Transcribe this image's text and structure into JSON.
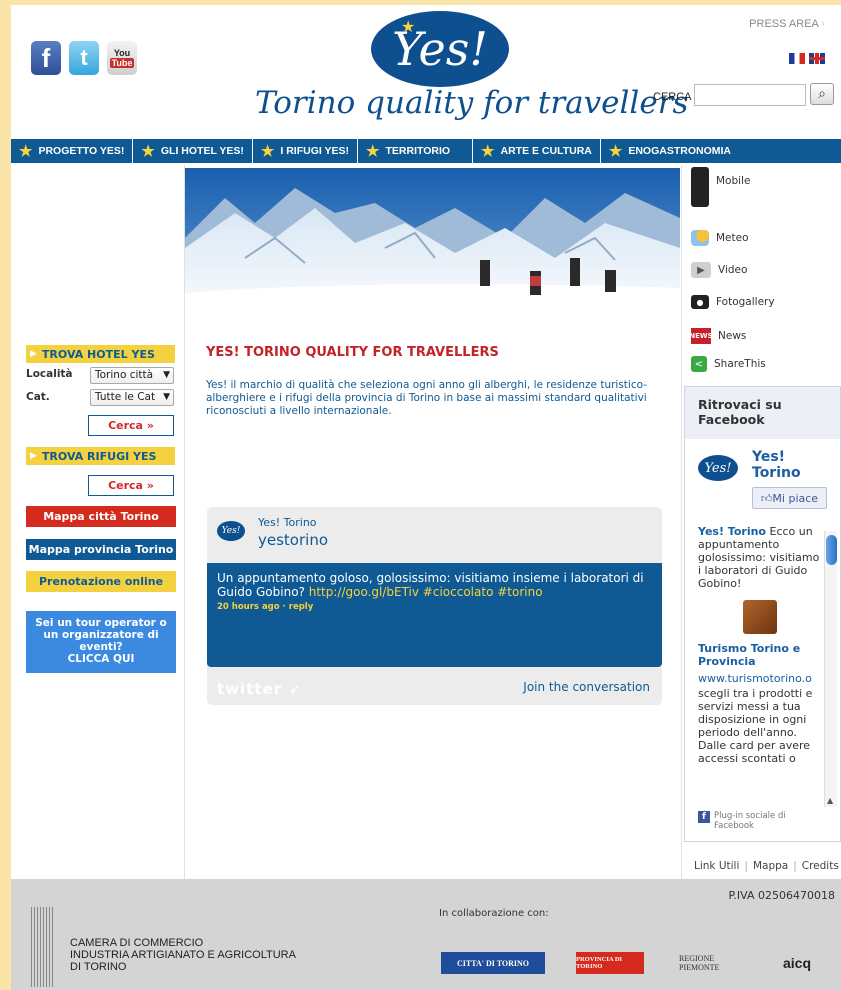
{
  "header": {
    "press_area": "PRESS AREA",
    "logo_text": "Yes!",
    "tagline": "Torino quality for travellers",
    "search_label": "CERCA",
    "search_placeholder": ""
  },
  "social": [
    {
      "name": "facebook",
      "glyph": "f"
    },
    {
      "name": "twitter",
      "glyph": "t"
    },
    {
      "name": "youtube",
      "glyph_top": "You",
      "glyph_bottom": "Tube"
    }
  ],
  "nav": [
    "PROGETTO YES!",
    "GLI HOTEL YES!",
    "I RIFUGI YES!",
    "TERRITORIO",
    "ARTE E CULTURA",
    "ENOGASTRONOMIA"
  ],
  "left": {
    "hotel_title": "TROVA HOTEL YES",
    "localita_label": "Località",
    "localita_value": "Torino città",
    "cat_label": "Cat.",
    "cat_value": "Tutte le Cat",
    "cerca_1": "Cerca »",
    "rifugi_title": "TROVA RIFUGI YES",
    "cerca_2": "Cerca »",
    "mappa_citta": "Mappa città Torino",
    "mappa_provincia": "Mappa provincia Torino",
    "prenotazione": "Prenotazione online",
    "tour_line1": "Sei un tour operator o",
    "tour_line2": "un organizzatore di",
    "tour_line3": "eventi?",
    "tour_line4": "CLICCA QUI"
  },
  "main": {
    "title": "YES! TORINO QUALITY FOR TRAVELLERS",
    "text": "Yes! il marchio di qualità che seleziona ogni anno gli alberghi, le residenze turistico-alberghiere e i rifugi della provincia di Torino in base ai massimi standard qualitativi riconosciuti a livello internazionale."
  },
  "twitter": {
    "name": "Yes! Torino",
    "handle": "yestorino",
    "avatar": "Yes!",
    "tweet_text": "Un appuntamento goloso, golosissimo: visitiamo insieme i laboratori di Guido Gobino? ",
    "tweet_link": "http://goo.gl/bETiv #cioccolato #torino",
    "meta": "20 hours ago · reply",
    "logo": "twitter",
    "join": "Join the conversation"
  },
  "right_links": [
    "Mobile",
    "Meteo",
    "Video",
    "Fotogallery",
    "News",
    "ShareThis"
  ],
  "facebook": {
    "title": "Ritrovaci su Facebook",
    "page_name": "Yes! Torino",
    "avatar": "Yes!",
    "like": "Mi piace",
    "post1_author": "Yes! Torino",
    "post1_text": " Ecco un appuntamento golosissimo: visitiamo i laboratori di Guido Gobino!",
    "post2_title": "Turismo Torino e Provincia",
    "post2_url": "www.turismotorino.o",
    "post2_text": "scegli tra i prodotti e servizi messi a tua disposizione in ogni periodo dell'anno. Dalle card per avere accessi scontati o",
    "plugin_text": "Plug-in sociale di Facebook"
  },
  "footer_links": [
    "Link Utili",
    "Mappa",
    "Credits"
  ],
  "footer": {
    "piva": "P.IVA 02506470018",
    "camera_line1": "CAMERA DI COMMERCIO",
    "camera_line2": "INDUSTRIA ARTIGIANATO E AGRICOLTURA",
    "camera_line3": "DI TORINO",
    "collab": "In collaborazione con:",
    "partner1": "CITTA' DI TORINO",
    "partner2": "PROVINCIA DI TORINO",
    "partner3": "REGIONE PIEMONTE",
    "partner4": "aicq"
  },
  "colors": {
    "brand_blue": "#0f5a94",
    "accent_yellow": "#f4d23f",
    "red": "#c4222a",
    "page_bg": "#fbe4a8"
  }
}
